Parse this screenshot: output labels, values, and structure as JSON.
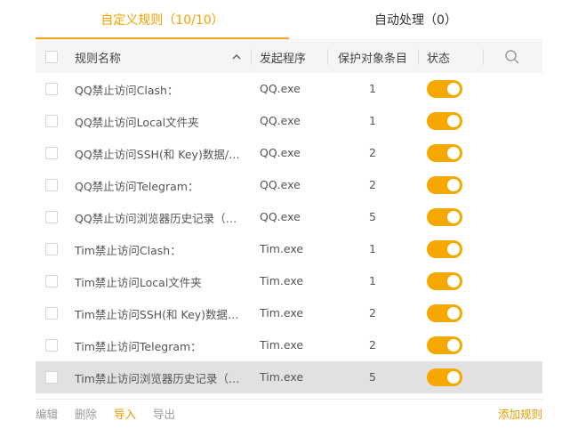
{
  "tabs": [
    {
      "label": "自定义规则（10/10）",
      "active": true
    },
    {
      "label": "自动处理（0）",
      "active": false
    }
  ],
  "columns": {
    "name": "规则名称",
    "process": "发起程序",
    "count": "保护对象条目",
    "status": "状态"
  },
  "icons": {
    "sort": "chevron-up-icon",
    "search": "search-icon"
  },
  "rules": [
    {
      "name": "QQ禁止访问Clash：",
      "process": "QQ.exe",
      "count": "1",
      "enabled": true
    },
    {
      "name": "QQ禁止访问Local文件夹",
      "process": "QQ.exe",
      "count": "1",
      "enabled": true
    },
    {
      "name": "QQ禁止访问SSH(和 Key)数据/GPG...",
      "process": "QQ.exe",
      "count": "2",
      "enabled": true
    },
    {
      "name": "QQ禁止访问Telegram：",
      "process": "QQ.exe",
      "count": "2",
      "enabled": true
    },
    {
      "name": "QQ禁止访问浏览器历史记录（Chr...",
      "process": "QQ.exe",
      "count": "5",
      "enabled": true
    },
    {
      "name": "Tim禁止访问Clash：",
      "process": "Tim.exe",
      "count": "1",
      "enabled": true
    },
    {
      "name": "Tim禁止访问Local文件夹",
      "process": "Tim.exe",
      "count": "1",
      "enabled": true
    },
    {
      "name": "Tim禁止访问SSH(和 Key)数据/GP...",
      "process": "Tim.exe",
      "count": "2",
      "enabled": true
    },
    {
      "name": "Tim禁止访问Telegram：",
      "process": "Tim.exe",
      "count": "2",
      "enabled": true
    },
    {
      "name": "Tim禁止访问浏览器历史记录（Chr...",
      "process": "Tim.exe",
      "count": "5",
      "enabled": true
    }
  ],
  "footer": {
    "edit": "编辑",
    "delete": "删除",
    "import": "导入",
    "export": "导出",
    "add": "添加规则"
  },
  "colors": {
    "accent": "#f5a800",
    "selected_row": "#e1e1e1"
  }
}
